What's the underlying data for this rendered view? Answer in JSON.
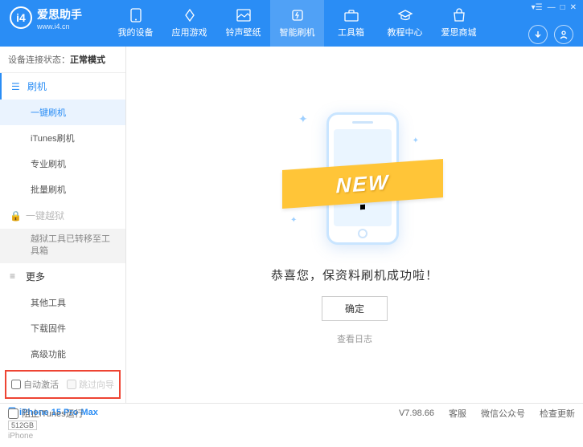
{
  "app": {
    "title": "爱思助手",
    "url": "www.i4.cn"
  },
  "nav": {
    "items": [
      {
        "label": "我的设备"
      },
      {
        "label": "应用游戏"
      },
      {
        "label": "铃声壁纸"
      },
      {
        "label": "智能刷机"
      },
      {
        "label": "工具箱"
      },
      {
        "label": "教程中心"
      },
      {
        "label": "爱思商城"
      }
    ]
  },
  "status": {
    "prefix": "设备连接状态：",
    "value": "正常模式"
  },
  "sidebar": {
    "flash": {
      "title": "刷机"
    },
    "flash_items": [
      "一键刷机",
      "iTunes刷机",
      "专业刷机",
      "批量刷机"
    ],
    "jailbreak": {
      "title": "一键越狱",
      "moved_text": "越狱工具已转移至工具箱"
    },
    "more": {
      "title": "更多"
    },
    "more_items": [
      "其他工具",
      "下载固件",
      "高级功能"
    ]
  },
  "checkboxes": {
    "auto_activate": "自动激活",
    "skip_guide": "跳过向导"
  },
  "device": {
    "name": "iPhone 15 Pro Max",
    "storage": "512GB",
    "type": "iPhone"
  },
  "main": {
    "ribbon": "NEW",
    "success": "恭喜您，保资料刷机成功啦！",
    "ok": "确定",
    "view_log": "查看日志"
  },
  "footer": {
    "block_itunes": "阻止iTunes运行",
    "version": "V7.98.66",
    "links": [
      "客服",
      "微信公众号",
      "检查更新"
    ]
  }
}
